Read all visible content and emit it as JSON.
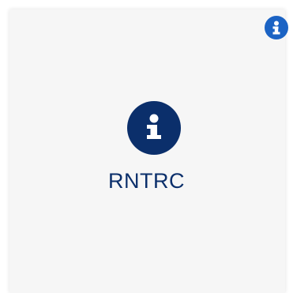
{
  "card": {
    "label": "RNTRC",
    "main_icon": "info-circle-icon",
    "corner_icon": "info-circle-icon"
  },
  "colors": {
    "card_background": "#f6f6f6",
    "main_icon_background": "#0b2f6b",
    "corner_icon_background": "#1b63c4",
    "icon_glyph": "#ffffff",
    "label_text": "#0b2f6b"
  }
}
